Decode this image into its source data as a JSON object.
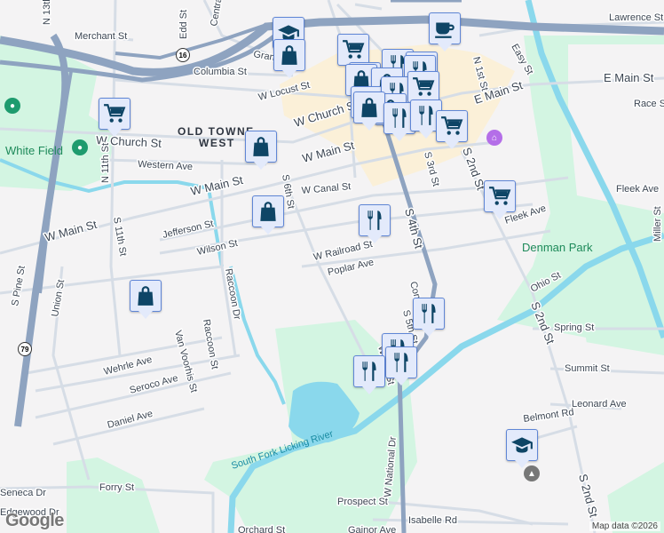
{
  "colors": {
    "highway": "#8ea3c0",
    "water": "#8ad8ec",
    "park": "#d3f5e2",
    "downtown": "#fbf0d8",
    "marker_bg": "#e3eafb",
    "marker_icon": "#0e4566"
  },
  "neighborhood": {
    "line1": "OLD TOWNE",
    "line2": "WEST"
  },
  "parks": {
    "white_field": "White Field",
    "denman_park": "Denman Park"
  },
  "river": "South Fork Licking River",
  "shields": {
    "sr16": "16",
    "sr79": "79"
  },
  "streets": {
    "n13th": "N 13th St",
    "merchant": "Merchant St",
    "columbia": "Columbia St",
    "grant": "Grant St",
    "w_locust": "W Locust St",
    "w_church_w": "W Church St",
    "w_church_e": "W Church St",
    "western": "Western Ave",
    "n11th": "N 11th St",
    "w_main_1": "W Main St",
    "w_main_2": "W Main St",
    "w_main_3": "W Main St",
    "w_canal": "W Canal St",
    "s6th": "S 6th St",
    "jefferson": "Jefferson St",
    "wilson": "Wilson St",
    "s11th": "S 11th St",
    "w_railroad": "W Railroad St",
    "poplar": "Poplar Ave",
    "s4th": "S 4th St",
    "s3rd": "S 3rd St",
    "s2nd_1": "S 2nd St",
    "s2nd_2": "S 2nd St",
    "s2nd_3": "S 2nd St",
    "n1st": "N 1st St",
    "easy": "Easy St",
    "e_main_1": "E Main St",
    "e_main_2": "E Main St",
    "lawrence": "Lawrence St",
    "race": "Race St",
    "fleek_1": "Fleek Ave",
    "fleek_2": "Fleek Ave",
    "miller": "Miller St",
    "ohio": "Ohio St",
    "spring": "Spring St",
    "summit": "Summit St",
    "leonard": "Leonard Ave",
    "belmont": "Belmont Rd",
    "s_pine": "S Pine St",
    "union": "Union St",
    "raccoon_dr": "Raccoon Dr",
    "raccoon_st": "Raccoon St",
    "van_voorhis": "Van Voorhis St",
    "wehrle": "Wehrle Ave",
    "seroco": "Seroco Ave",
    "daniel": "Daniel Ave",
    "w_national": "W National Dr",
    "seneca": "Seneca Dr",
    "edgewood": "Edgewood Dr",
    "forry": "Forry St",
    "prospect": "Prospect St",
    "isabelle": "Isabelle Rd",
    "gainor": "Gainor Ave",
    "orchard": "Orchard St",
    "edd": "Edd St",
    "central": "Central Ave",
    "s5th": "S 5th St",
    "conch": "Conch St",
    "willow": "Willow St"
  },
  "markers": [
    "school",
    "shopping",
    "cafe",
    "grocery",
    "grocery",
    "shopping",
    "restaurant",
    "grocery",
    "restaurant",
    "shopping",
    "shopping",
    "restaurant",
    "grocery",
    "shopping",
    "shopping",
    "restaurant",
    "restaurant",
    "grocery",
    "grocery",
    "shopping",
    "shopping",
    "grocery",
    "restaurant",
    "shopping",
    "restaurant",
    "restaurant",
    "restaurant",
    "restaurant",
    "school"
  ],
  "attribution": "Map data ©2026",
  "logo": "Google"
}
